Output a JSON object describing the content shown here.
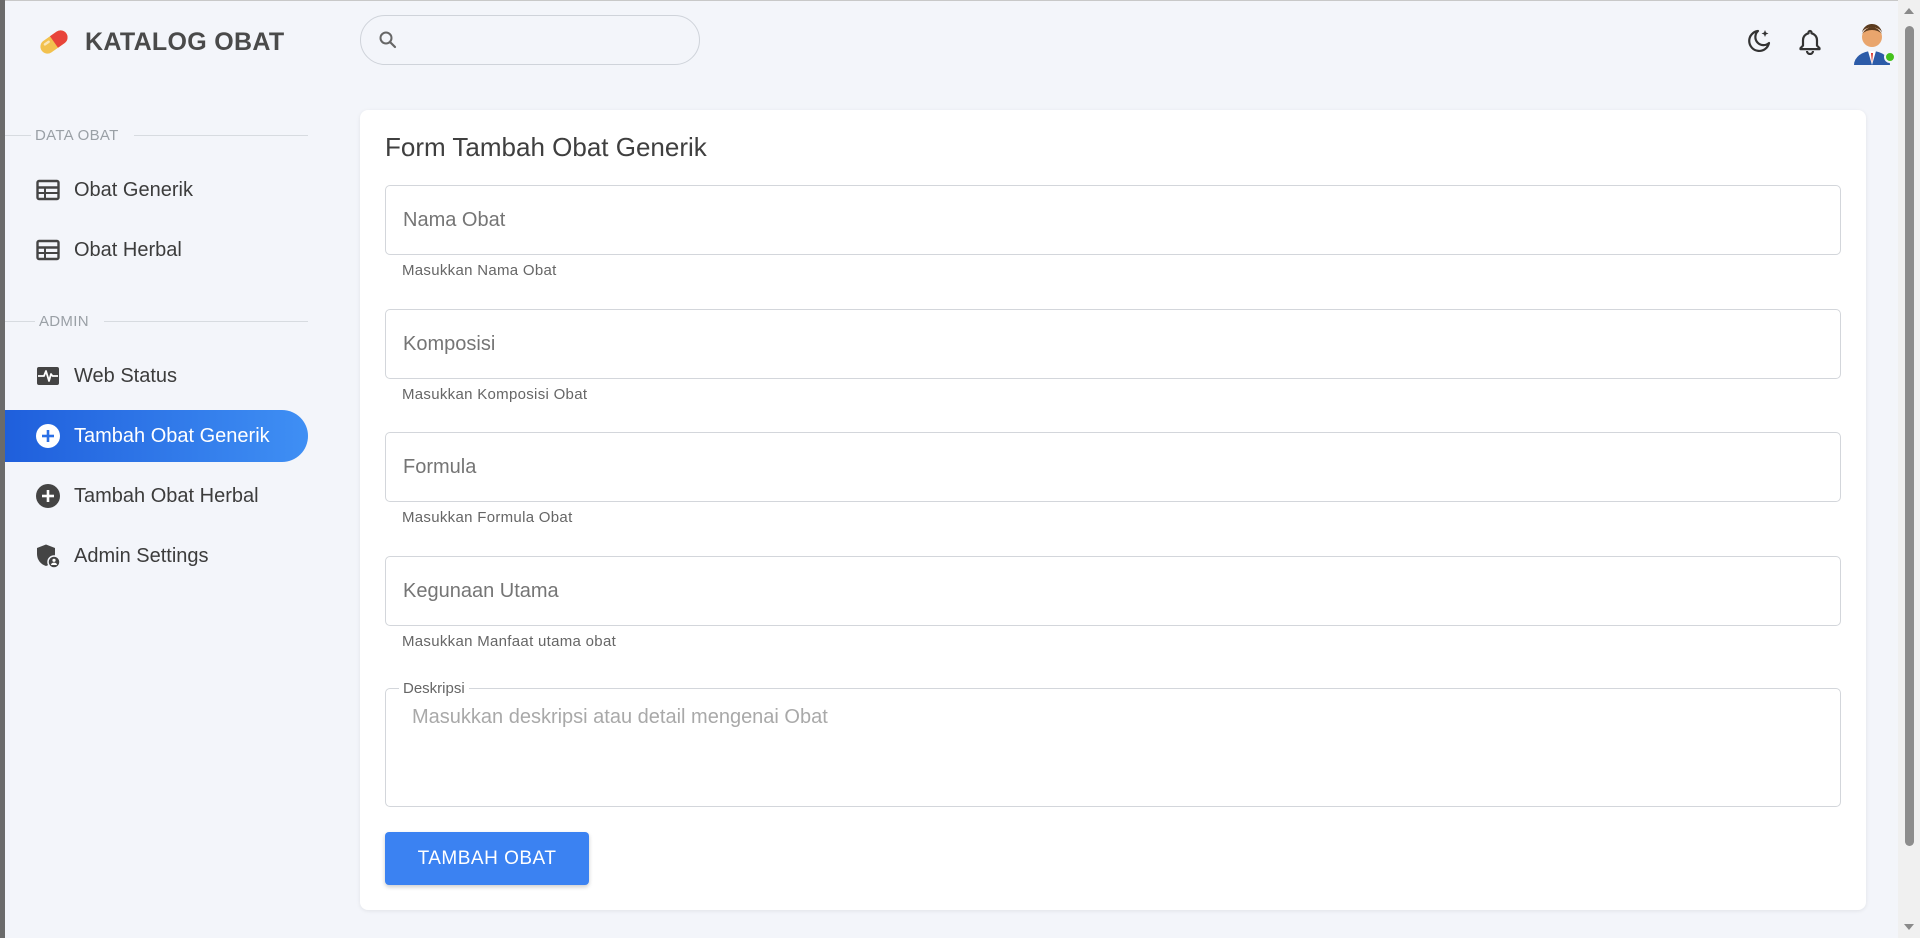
{
  "app": {
    "title": "KATALOG OBAT"
  },
  "search": {
    "placeholder": ""
  },
  "header": {
    "icons": [
      "dark-mode-icon",
      "bell-icon",
      "user-avatar"
    ]
  },
  "sidebar": {
    "sections": [
      {
        "label": "DATA OBAT",
        "items": [
          {
            "label": "Obat Generik",
            "icon": "table-icon",
            "active": false
          },
          {
            "label": "Obat Herbal",
            "icon": "table-icon",
            "active": false
          }
        ]
      },
      {
        "label": "ADMIN",
        "items": [
          {
            "label": "Web Status",
            "icon": "monitor-heart-icon",
            "active": false
          },
          {
            "label": "Tambah Obat Generik",
            "icon": "add-circle-icon",
            "active": true
          },
          {
            "label": "Tambah Obat Herbal",
            "icon": "add-circle-icon",
            "active": false
          },
          {
            "label": "Admin Settings",
            "icon": "admin-shield-icon",
            "active": false
          }
        ]
      }
    ]
  },
  "form": {
    "title": "Form Tambah Obat Generik",
    "fields": [
      {
        "placeholder": "Nama Obat",
        "helper": "Masukkan Nama Obat",
        "value": ""
      },
      {
        "placeholder": "Komposisi",
        "helper": "Masukkan Komposisi Obat",
        "value": ""
      },
      {
        "placeholder": "Formula",
        "helper": "Masukkan Formula Obat",
        "value": ""
      },
      {
        "placeholder": "Kegunaan Utama",
        "helper": "Masukkan Manfaat utama obat",
        "value": ""
      }
    ],
    "description": {
      "label": "Deskripsi",
      "placeholder": "Masukkan deskripsi atau detail mengenai Obat"
    },
    "submit_label": "TAMBAH OBAT"
  },
  "colors": {
    "accent": "#3b82f2",
    "active_nav_start": "#1f5fdc",
    "active_nav_end": "#3f8ff4",
    "background": "#f3f5fa",
    "online": "#44c21d"
  }
}
